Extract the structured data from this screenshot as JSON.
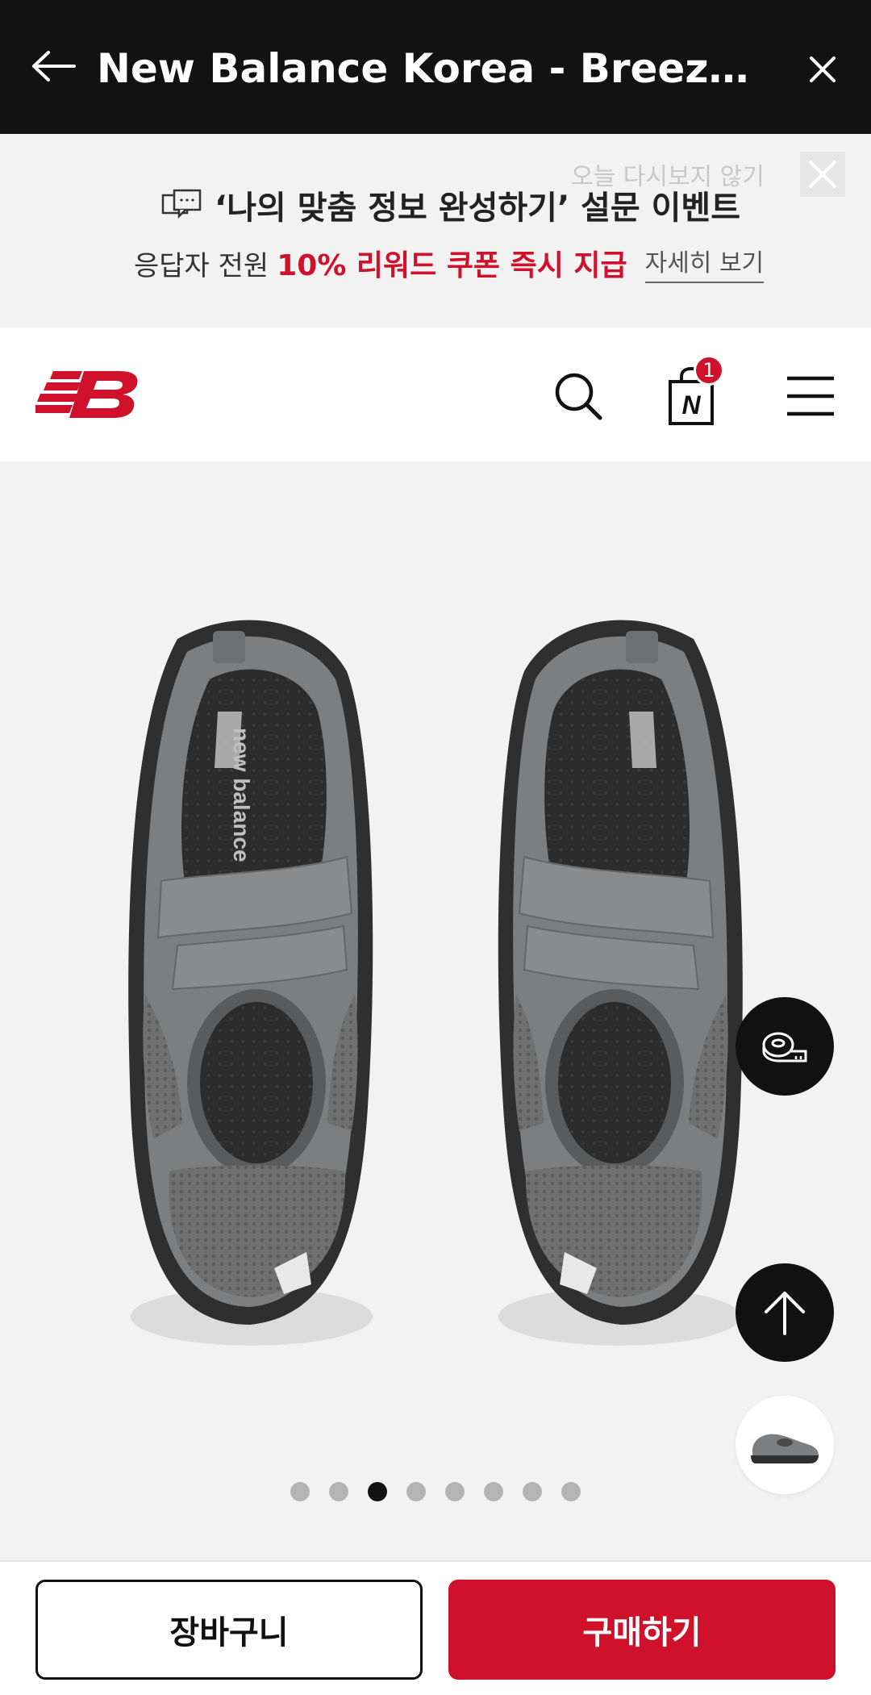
{
  "appbar": {
    "title": "New Balance Korea - Breeze / SD···",
    "back_icon": "arrow-left-icon",
    "close_icon": "close-icon"
  },
  "promo": {
    "dismiss_label": "오늘 다시보지 않기",
    "headline": "‘나의 맞춤 정보 완성하기’ 설문 이벤트",
    "sub_pre": "응답자 전원",
    "sub_highlight": "10% 리워드 쿠폰 즉시 지급",
    "more_label": "자세히 보기"
  },
  "header": {
    "cart_count": "1",
    "cart_letter": "N"
  },
  "gallery": {
    "slide_count": 8,
    "active_slide": 3,
    "insole_text": "new balance"
  },
  "bottom": {
    "cart_label": "장바구니",
    "buy_label": "구매하기"
  },
  "colors": {
    "brand_red": "#d0112b",
    "appbar_bg": "#121212"
  }
}
